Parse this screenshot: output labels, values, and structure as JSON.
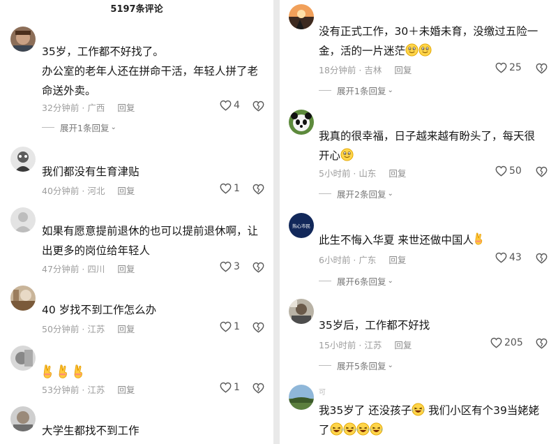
{
  "header": {
    "comment_count": "5197条评论"
  },
  "left": [
    {
      "lines": [
        "35岁，工作都不好找了。",
        "办公室的老年人还在拼命干活，年轻人拼了老",
        "命送外卖。"
      ],
      "time": "32分钟前",
      "region": "广西",
      "reply": "回复",
      "likes": "4",
      "expand": "展开1条回复"
    },
    {
      "lines": [
        "我们都没有生育津贴"
      ],
      "time": "40分钟前",
      "region": "河北",
      "reply": "回复",
      "likes": "1"
    },
    {
      "lines": [
        "如果有愿意提前退休的也可以提前退休啊，让",
        "出更多的岗位给年轻人"
      ],
      "time": "47分钟前",
      "region": "四川",
      "reply": "回复",
      "likes": "3"
    },
    {
      "lines": [
        "40 岁找不到工作怎么办"
      ],
      "time": "50分钟前",
      "region": "江苏",
      "reply": "回复",
      "likes": "1"
    },
    {
      "emoji": [
        "fingers-crossed-emoji",
        "fingers-crossed-emoji",
        "fingers-crossed-emoji"
      ],
      "time": "53分钟前",
      "region": "江苏",
      "reply": "回复",
      "likes": "1"
    },
    {
      "lines": [
        "大学生都找不到工作"
      ]
    }
  ],
  "right": [
    {
      "line1": "没有正式工作，30＋未婚未育，没缴过五险一",
      "line2": "金，活的一片迷茫",
      "time": "18分钟前",
      "region": "吉林",
      "reply": "回复",
      "likes": "25",
      "expand": "展开1条回复"
    },
    {
      "line1": "我真的很幸福，日子越来越有盼头了，每天很",
      "line2": "开心",
      "time": "5小时前",
      "region": "山东",
      "reply": "回复",
      "likes": "50",
      "expand": "展开2条回复"
    },
    {
      "line1": "此生不悔入华夏 来世还做中国人",
      "avatar_text": "热心市民",
      "time": "6小时前",
      "region": "广东",
      "reply": "回复",
      "likes": "43",
      "expand": "展开6条回复"
    },
    {
      "line1": "35岁后，工作都不好找",
      "time": "15小时前",
      "region": "江苏",
      "reply": "回复",
      "likes": "205",
      "expand": "展开5条回复"
    },
    {
      "line1a": "我35岁了 还没孩子",
      "line1b": " 我们小区有个39当姥姥",
      "line2": "了",
      "username": "可"
    }
  ],
  "colors": {
    "background": "#ffffff",
    "text": "#161616",
    "meta": "#9d9d9d",
    "divider": "#e9e9e9"
  }
}
